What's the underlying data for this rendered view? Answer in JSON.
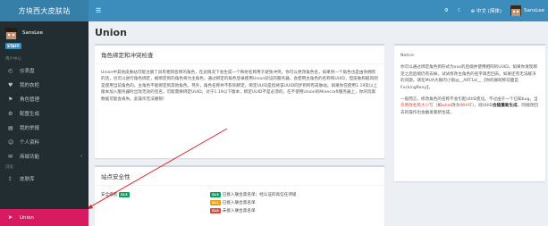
{
  "sidebar": {
    "brand": "方块西大皮肤站",
    "user": {
      "name": "SansLee",
      "badge": "STAFF"
    },
    "section_user": "用户中心",
    "items": [
      {
        "icon": "◴",
        "label": "仪表盘"
      },
      {
        "icon": "♥",
        "label": "我的衣柜"
      },
      {
        "icon": "⚑",
        "label": "角色管理"
      },
      {
        "icon": "⚙",
        "label": "配置生成"
      },
      {
        "icon": "▤",
        "label": "我的举报"
      },
      {
        "icon": "☺",
        "label": "个人资料"
      },
      {
        "icon": "✉",
        "label": "商城功能",
        "chevron": "‹"
      }
    ],
    "section_explore": "浏览",
    "items2": [
      {
        "icon": "⇪",
        "label": "皮肤库"
      }
    ],
    "active": {
      "icon": "➤",
      "label": "Union"
    }
  },
  "topbar": {
    "menu_icon": "☰",
    "gear_icon": "⚙",
    "moon_icon": "☾",
    "language": "中文 (简体)",
    "user": "SansLee"
  },
  "content": {
    "title": "Union",
    "box1": {
      "title": "角色绑定和冲突检查",
      "text": "Union中其他皮肤站可能注册了具有相同名称的角色，在此情况下会生成一个映射名称用于避免冲突。你可以更改角色名，如果另一个角色也是由你拥有的话，也可以进行角色绑定，被绑定到的角色将为主角色。通过绑定的角色登录使用Union验证的服务器，会使用主角色的名称和UUID，但皮肤和披风则是使用当前角色的。主角色不能绑定到其他角色。另外，角色名称并不影响绑定。绑定UUID是指将该UUID同步到所有皮肤站。如果你在使用1.19及以上版本加入服务器时出现无效的签名，可能需要绑定UUID。对于1.19以下版本，绑定UUID不是必须的。在不使用Union的Minecraft服务器上，你的玩家数据可能会丢失。此操作无法撤销！"
    },
    "box2": {
      "title": "Notice:",
      "p1": "你可以通过绑定角色到形式为xxx的后缀并使用相同的UUID。如果你发现绑定之后后缀仍有去掉，试试修改主角色的名字再否回去。如果还有无法解决的问题，请在MUA大群内小窗@__ART1st__【你的群昵称前面是FvckingReny】。",
      "p2_pre": "一般而言，修改角色的名称不会引起UUID变化。不过由于一个已知bug，当",
      "p2_red1": "仅更改名称大小写",
      "p2_mid1": "（如",
      "p2_red2": "what",
      "p2_mid2": "改为",
      "p2_red3": "WHAT",
      "p2_mid3": "），则UUID",
      "p2_bold": "会随重新生成",
      "p2_post": "，同继改回去的操作也会触发重新生成。"
    },
    "box3": {
      "title": "站点安全性",
      "site_label": "安全级别",
      "site_level": "SL3",
      "legend": [
        {
          "level": "SL3",
          "text": "已接入联合黑名单；经认证的高信任评级"
        },
        {
          "level": "SL1",
          "text": "已接入联合黑名单"
        },
        {
          "level": "SL0",
          "text": "未接入联合黑名单"
        }
      ]
    }
  }
}
